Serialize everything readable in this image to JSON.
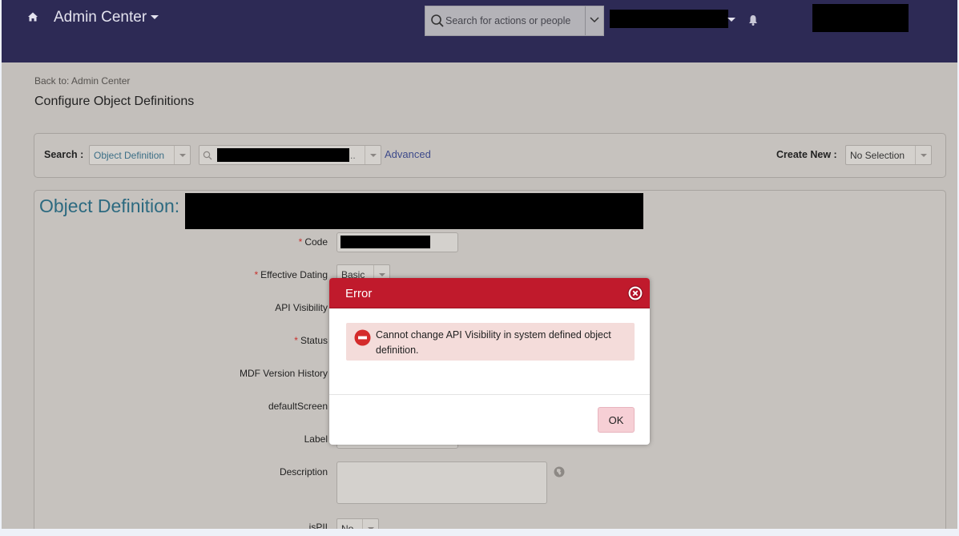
{
  "header": {
    "app_title": "Admin Center",
    "search_placeholder": "Search for actions or people"
  },
  "page": {
    "back_link": "Back to: Admin Center",
    "title": "Configure Object Definitions"
  },
  "search_panel": {
    "search_label": "Search :",
    "search_type_value": "Object Definition",
    "advanced_link": "Advanced",
    "create_new_label": "Create New :",
    "create_new_value": "No Selection"
  },
  "object_panel": {
    "heading": "Object Definition:",
    "fields": {
      "code": "Code",
      "effective_dating": "Effective Dating",
      "effective_dating_value": "Basic",
      "api_visibility": "API Visibility",
      "status": "Status",
      "mdf_version_history": "MDF Version History",
      "default_screen": "defaultScreen",
      "label": "Label",
      "description": "Description",
      "is_pii": "isPII",
      "is_pii_value": "No"
    }
  },
  "dialog": {
    "title": "Error",
    "message": "Cannot change API Visibility in system defined object definition.",
    "ok_label": "OK"
  },
  "colors": {
    "header_bg": "#2d2a55",
    "error_red": "#c01a2c",
    "heading_teal": "#2d6a80",
    "required_star": "#c9302c"
  }
}
